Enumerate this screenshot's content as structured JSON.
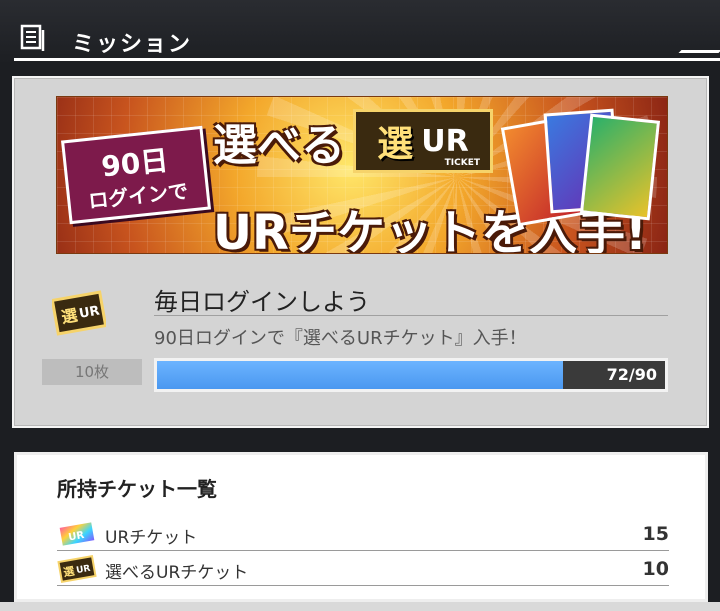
{
  "header": {
    "title": "ミッション",
    "icon": "list-icon"
  },
  "mission": {
    "banner": {
      "badge_line1": "90日",
      "badge_line2": "ログインで",
      "headline": "選べる",
      "emblem_kanji": "選",
      "emblem_ur": "UR",
      "emblem_sub": "TICKET",
      "footline": "URチケットを入手!"
    },
    "title": "毎日ログインしよう",
    "description": "90日ログインで『選べるURチケット』入手！",
    "reward_count": "10枚",
    "progress": {
      "current": 72,
      "total": 90,
      "label": "72/90"
    }
  },
  "owned": {
    "title": "所持チケット一覧",
    "tickets": [
      {
        "label": "URチケット",
        "count": "15",
        "icon": "ur-ticket-icon"
      },
      {
        "label": "選べるURチケット",
        "count": "10",
        "icon": "select-ur-ticket-icon"
      }
    ]
  },
  "colors": {
    "progress_fill": "#4a98f0",
    "panel_bg": "#d4d4d4",
    "header_bg": "#1d1f23"
  }
}
